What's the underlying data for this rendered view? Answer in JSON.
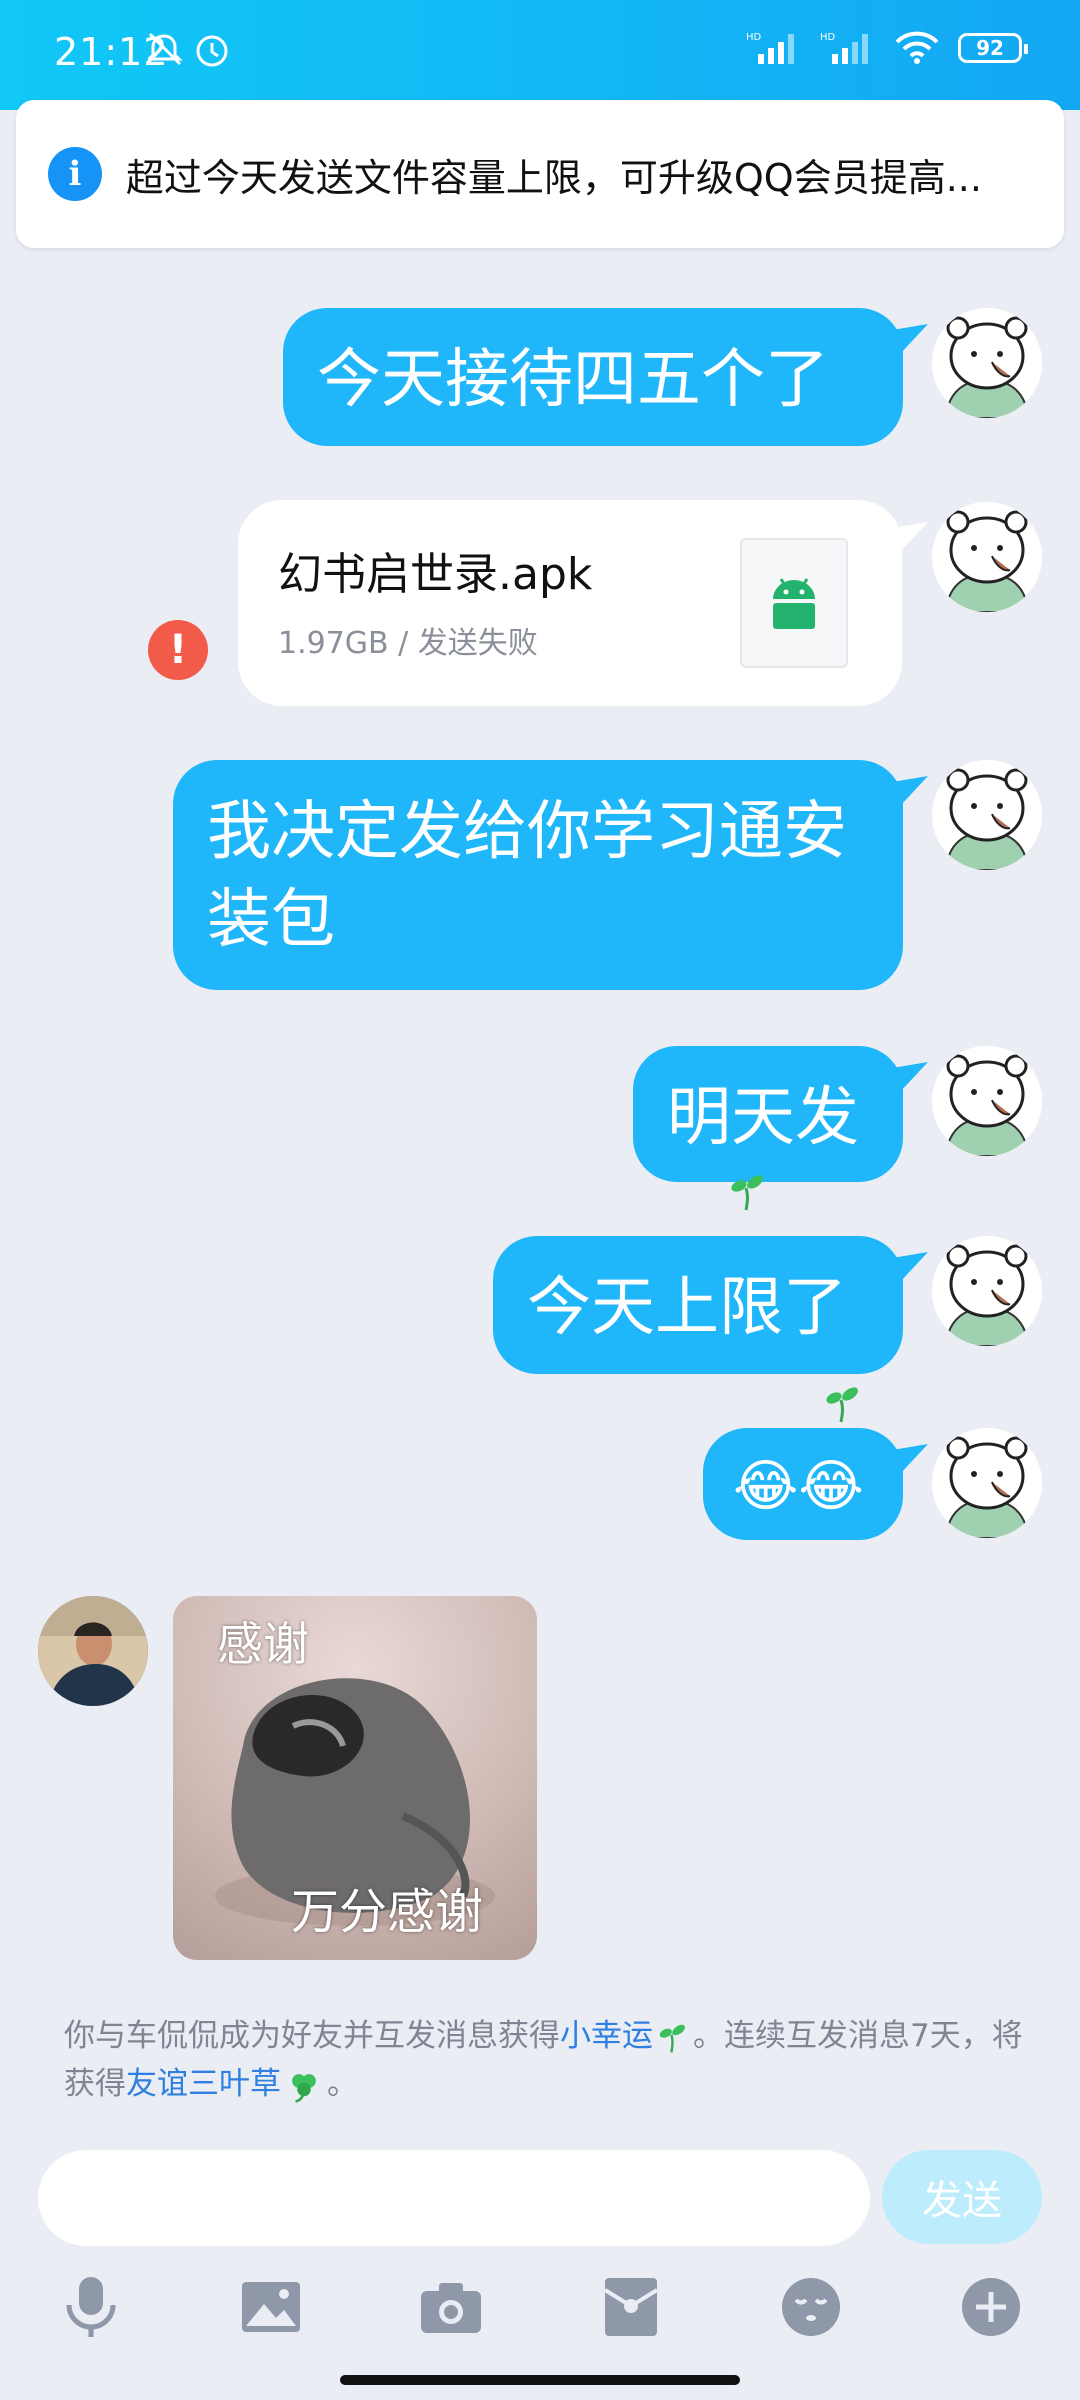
{
  "status_bar": {
    "time": "21:12",
    "battery": "92"
  },
  "banner": {
    "text": "超过今天发送文件容量上限，可升级QQ会员提高..."
  },
  "messages": [
    {
      "type": "text",
      "text": "今天接待四五个了"
    },
    {
      "type": "file",
      "name": "幻书启世录.apk",
      "meta": "1.97GB / 发送失败",
      "failed_icon": "!"
    },
    {
      "type": "text",
      "text": "我决定发给你学习通安装包"
    },
    {
      "type": "text",
      "text": "明天发"
    },
    {
      "type": "text",
      "text": "今天上限了"
    },
    {
      "type": "emoji",
      "text": "😂😂"
    },
    {
      "type": "sticker",
      "top_text": "感谢",
      "bottom_text": "万分感谢"
    }
  ],
  "system_message": {
    "part1": "你与车侃侃成为好友并互发消息获得",
    "link1": "小幸运",
    "part2": "。连续互发消息7天，将获得",
    "link2": "友谊三叶草",
    "part3": "。"
  },
  "composer": {
    "send_label": "发送"
  },
  "toolbar": {
    "icons": [
      "mic-icon",
      "image-icon",
      "camera-icon",
      "red-packet-icon",
      "emoji-icon",
      "plus-icon"
    ]
  },
  "colors": {
    "bubble": "#20B7FA",
    "accent": "#1593F6",
    "error": "#F25B4A",
    "link": "#2E7FE0"
  }
}
